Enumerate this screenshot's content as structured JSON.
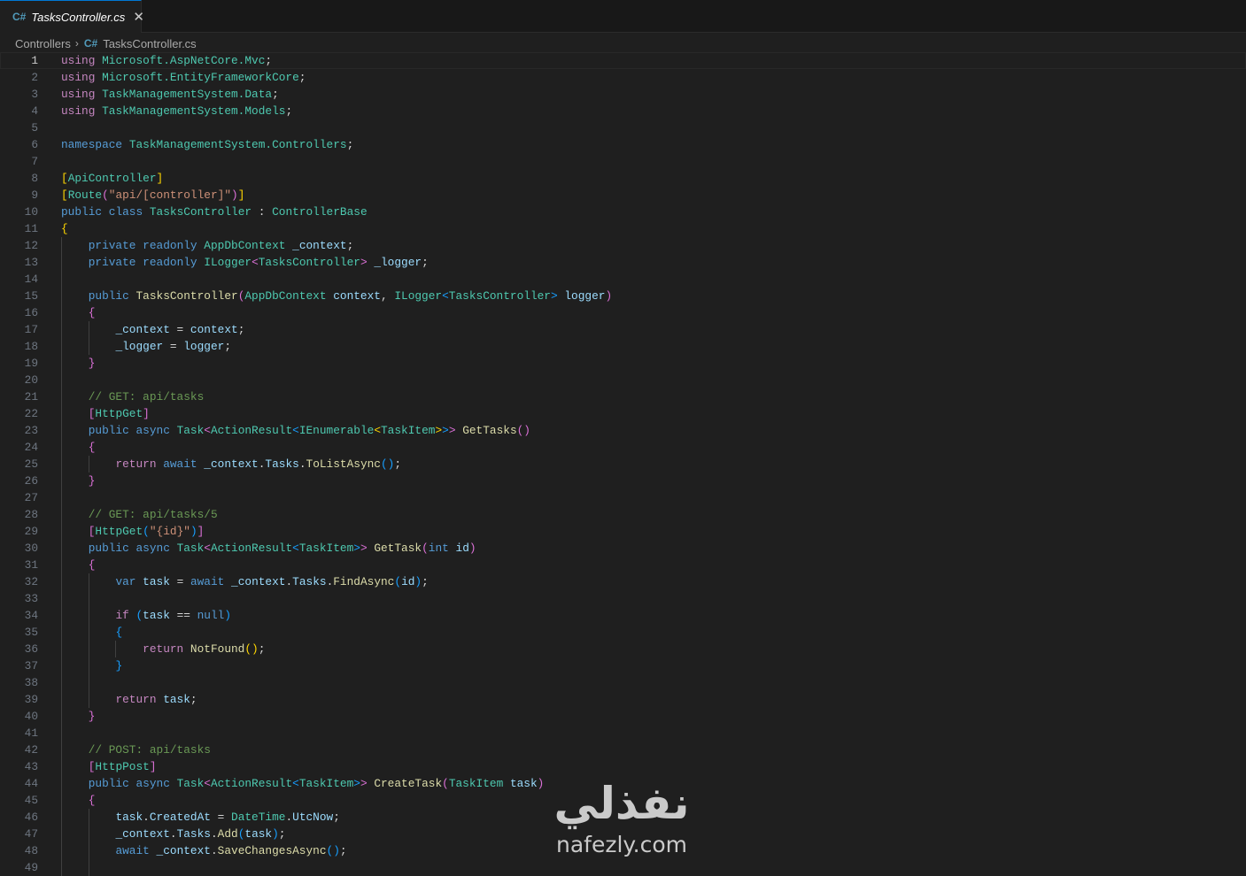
{
  "tab": {
    "icon": "csharp-file-icon",
    "label": "TasksController.cs"
  },
  "breadcrumb": {
    "folder": "Controllers",
    "file": "TasksController.cs"
  },
  "active_line": 1,
  "watermark": {
    "arabic": "نفذلي",
    "latin": "nafezly.com"
  },
  "lines": [
    {
      "n": "1",
      "indent": 0,
      "tokens": [
        [
          "c",
          "using"
        ],
        [
          "p",
          " "
        ],
        [
          "t",
          "Microsoft.AspNetCore.Mvc"
        ],
        [
          "p",
          ";"
        ]
      ]
    },
    {
      "n": "2",
      "indent": 0,
      "tokens": [
        [
          "c",
          "using"
        ],
        [
          "p",
          " "
        ],
        [
          "t",
          "Microsoft.EntityFrameworkCore"
        ],
        [
          "p",
          ";"
        ]
      ]
    },
    {
      "n": "3",
      "indent": 0,
      "tokens": [
        [
          "c",
          "using"
        ],
        [
          "p",
          " "
        ],
        [
          "t",
          "TaskManagementSystem.Data"
        ],
        [
          "p",
          ";"
        ]
      ]
    },
    {
      "n": "4",
      "indent": 0,
      "tokens": [
        [
          "c",
          "using"
        ],
        [
          "p",
          " "
        ],
        [
          "t",
          "TaskManagementSystem.Models"
        ],
        [
          "p",
          ";"
        ]
      ]
    },
    {
      "n": "5",
      "indent": 0,
      "tokens": []
    },
    {
      "n": "6",
      "indent": 0,
      "tokens": [
        [
          "k",
          "namespace"
        ],
        [
          "p",
          " "
        ],
        [
          "t",
          "TaskManagementSystem.Controllers"
        ],
        [
          "p",
          ";"
        ]
      ]
    },
    {
      "n": "7",
      "indent": 0,
      "tokens": []
    },
    {
      "n": "8",
      "indent": 0,
      "tokens": [
        [
          "b1",
          "["
        ],
        [
          "t",
          "ApiController"
        ],
        [
          "b1",
          "]"
        ]
      ]
    },
    {
      "n": "9",
      "indent": 0,
      "tokens": [
        [
          "b1",
          "["
        ],
        [
          "t",
          "Route"
        ],
        [
          "b2",
          "("
        ],
        [
          "s",
          "\"api/[controller]\""
        ],
        [
          "b2",
          ")"
        ],
        [
          "b1",
          "]"
        ]
      ]
    },
    {
      "n": "10",
      "indent": 0,
      "tokens": [
        [
          "k",
          "public"
        ],
        [
          "p",
          " "
        ],
        [
          "k",
          "class"
        ],
        [
          "p",
          " "
        ],
        [
          "t",
          "TasksController"
        ],
        [
          "p",
          " : "
        ],
        [
          "t",
          "ControllerBase"
        ]
      ]
    },
    {
      "n": "11",
      "indent": 0,
      "tokens": [
        [
          "b1",
          "{"
        ]
      ]
    },
    {
      "n": "12",
      "indent": 1,
      "tokens": [
        [
          "k",
          "private"
        ],
        [
          "p",
          " "
        ],
        [
          "k",
          "readonly"
        ],
        [
          "p",
          " "
        ],
        [
          "t",
          "AppDbContext"
        ],
        [
          "p",
          " "
        ],
        [
          "v",
          "_context"
        ],
        [
          "p",
          ";"
        ]
      ]
    },
    {
      "n": "13",
      "indent": 1,
      "tokens": [
        [
          "k",
          "private"
        ],
        [
          "p",
          " "
        ],
        [
          "k",
          "readonly"
        ],
        [
          "p",
          " "
        ],
        [
          "t",
          "ILogger"
        ],
        [
          "b2",
          "<"
        ],
        [
          "t",
          "TasksController"
        ],
        [
          "b2",
          ">"
        ],
        [
          "p",
          " "
        ],
        [
          "v",
          "_logger"
        ],
        [
          "p",
          ";"
        ]
      ]
    },
    {
      "n": "14",
      "indent": 1,
      "tokens": []
    },
    {
      "n": "15",
      "indent": 1,
      "tokens": [
        [
          "k",
          "public"
        ],
        [
          "p",
          " "
        ],
        [
          "f",
          "TasksController"
        ],
        [
          "b2",
          "("
        ],
        [
          "t",
          "AppDbContext"
        ],
        [
          "p",
          " "
        ],
        [
          "v",
          "context"
        ],
        [
          "p",
          ", "
        ],
        [
          "t",
          "ILogger"
        ],
        [
          "b3",
          "<"
        ],
        [
          "t",
          "TasksController"
        ],
        [
          "b3",
          ">"
        ],
        [
          "p",
          " "
        ],
        [
          "v",
          "logger"
        ],
        [
          "b2",
          ")"
        ]
      ]
    },
    {
      "n": "16",
      "indent": 1,
      "tokens": [
        [
          "b2",
          "{"
        ]
      ]
    },
    {
      "n": "17",
      "indent": 2,
      "tokens": [
        [
          "v",
          "_context"
        ],
        [
          "p",
          " = "
        ],
        [
          "v",
          "context"
        ],
        [
          "p",
          ";"
        ]
      ]
    },
    {
      "n": "18",
      "indent": 2,
      "tokens": [
        [
          "v",
          "_logger"
        ],
        [
          "p",
          " = "
        ],
        [
          "v",
          "logger"
        ],
        [
          "p",
          ";"
        ]
      ]
    },
    {
      "n": "19",
      "indent": 1,
      "tokens": [
        [
          "b2",
          "}"
        ]
      ]
    },
    {
      "n": "20",
      "indent": 1,
      "tokens": []
    },
    {
      "n": "21",
      "indent": 1,
      "tokens": [
        [
          "m",
          "// GET: api/tasks"
        ]
      ]
    },
    {
      "n": "22",
      "indent": 1,
      "tokens": [
        [
          "b2",
          "["
        ],
        [
          "t",
          "HttpGet"
        ],
        [
          "b2",
          "]"
        ]
      ]
    },
    {
      "n": "23",
      "indent": 1,
      "tokens": [
        [
          "k",
          "public"
        ],
        [
          "p",
          " "
        ],
        [
          "k",
          "async"
        ],
        [
          "p",
          " "
        ],
        [
          "t",
          "Task"
        ],
        [
          "b2",
          "<"
        ],
        [
          "t",
          "ActionResult"
        ],
        [
          "b3",
          "<"
        ],
        [
          "t",
          "IEnumerable"
        ],
        [
          "b1",
          "<"
        ],
        [
          "t",
          "TaskItem"
        ],
        [
          "b1",
          ">"
        ],
        [
          "b3",
          ">"
        ],
        [
          "b2",
          ">"
        ],
        [
          "p",
          " "
        ],
        [
          "f",
          "GetTasks"
        ],
        [
          "b2",
          "()"
        ]
      ]
    },
    {
      "n": "24",
      "indent": 1,
      "tokens": [
        [
          "b2",
          "{"
        ]
      ]
    },
    {
      "n": "25",
      "indent": 2,
      "tokens": [
        [
          "c",
          "return"
        ],
        [
          "p",
          " "
        ],
        [
          "k",
          "await"
        ],
        [
          "p",
          " "
        ],
        [
          "v",
          "_context"
        ],
        [
          "p",
          "."
        ],
        [
          "v",
          "Tasks"
        ],
        [
          "p",
          "."
        ],
        [
          "f",
          "ToListAsync"
        ],
        [
          "b3",
          "()"
        ],
        [
          "p",
          ";"
        ]
      ]
    },
    {
      "n": "26",
      "indent": 1,
      "tokens": [
        [
          "b2",
          "}"
        ]
      ]
    },
    {
      "n": "27",
      "indent": 1,
      "tokens": []
    },
    {
      "n": "28",
      "indent": 1,
      "tokens": [
        [
          "m",
          "// GET: api/tasks/5"
        ]
      ]
    },
    {
      "n": "29",
      "indent": 1,
      "tokens": [
        [
          "b2",
          "["
        ],
        [
          "t",
          "HttpGet"
        ],
        [
          "b3",
          "("
        ],
        [
          "s",
          "\"{id}\""
        ],
        [
          "b3",
          ")"
        ],
        [
          "b2",
          "]"
        ]
      ]
    },
    {
      "n": "30",
      "indent": 1,
      "tokens": [
        [
          "k",
          "public"
        ],
        [
          "p",
          " "
        ],
        [
          "k",
          "async"
        ],
        [
          "p",
          " "
        ],
        [
          "t",
          "Task"
        ],
        [
          "b2",
          "<"
        ],
        [
          "t",
          "ActionResult"
        ],
        [
          "b3",
          "<"
        ],
        [
          "t",
          "TaskItem"
        ],
        [
          "b3",
          ">"
        ],
        [
          "b2",
          ">"
        ],
        [
          "p",
          " "
        ],
        [
          "f",
          "GetTask"
        ],
        [
          "b2",
          "("
        ],
        [
          "k",
          "int"
        ],
        [
          "p",
          " "
        ],
        [
          "v",
          "id"
        ],
        [
          "b2",
          ")"
        ]
      ]
    },
    {
      "n": "31",
      "indent": 1,
      "tokens": [
        [
          "b2",
          "{"
        ]
      ]
    },
    {
      "n": "32",
      "indent": 2,
      "tokens": [
        [
          "k",
          "var"
        ],
        [
          "p",
          " "
        ],
        [
          "v",
          "task"
        ],
        [
          "p",
          " = "
        ],
        [
          "k",
          "await"
        ],
        [
          "p",
          " "
        ],
        [
          "v",
          "_context"
        ],
        [
          "p",
          "."
        ],
        [
          "v",
          "Tasks"
        ],
        [
          "p",
          "."
        ],
        [
          "f",
          "FindAsync"
        ],
        [
          "b3",
          "("
        ],
        [
          "v",
          "id"
        ],
        [
          "b3",
          ")"
        ],
        [
          "p",
          ";"
        ]
      ]
    },
    {
      "n": "33",
      "indent": 2,
      "tokens": []
    },
    {
      "n": "34",
      "indent": 2,
      "tokens": [
        [
          "c",
          "if"
        ],
        [
          "p",
          " "
        ],
        [
          "b3",
          "("
        ],
        [
          "v",
          "task"
        ],
        [
          "p",
          " == "
        ],
        [
          "k",
          "null"
        ],
        [
          "b3",
          ")"
        ]
      ]
    },
    {
      "n": "35",
      "indent": 2,
      "tokens": [
        [
          "b3",
          "{"
        ]
      ]
    },
    {
      "n": "36",
      "indent": 3,
      "tokens": [
        [
          "c",
          "return"
        ],
        [
          "p",
          " "
        ],
        [
          "f",
          "NotFound"
        ],
        [
          "b1",
          "()"
        ],
        [
          "p",
          ";"
        ]
      ]
    },
    {
      "n": "37",
      "indent": 2,
      "tokens": [
        [
          "b3",
          "}"
        ]
      ]
    },
    {
      "n": "38",
      "indent": 2,
      "tokens": []
    },
    {
      "n": "39",
      "indent": 2,
      "tokens": [
        [
          "c",
          "return"
        ],
        [
          "p",
          " "
        ],
        [
          "v",
          "task"
        ],
        [
          "p",
          ";"
        ]
      ]
    },
    {
      "n": "40",
      "indent": 1,
      "tokens": [
        [
          "b2",
          "}"
        ]
      ]
    },
    {
      "n": "41",
      "indent": 1,
      "tokens": []
    },
    {
      "n": "42",
      "indent": 1,
      "tokens": [
        [
          "m",
          "// POST: api/tasks"
        ]
      ]
    },
    {
      "n": "43",
      "indent": 1,
      "tokens": [
        [
          "b2",
          "["
        ],
        [
          "t",
          "HttpPost"
        ],
        [
          "b2",
          "]"
        ]
      ]
    },
    {
      "n": "44",
      "indent": 1,
      "tokens": [
        [
          "k",
          "public"
        ],
        [
          "p",
          " "
        ],
        [
          "k",
          "async"
        ],
        [
          "p",
          " "
        ],
        [
          "t",
          "Task"
        ],
        [
          "b2",
          "<"
        ],
        [
          "t",
          "ActionResult"
        ],
        [
          "b3",
          "<"
        ],
        [
          "t",
          "TaskItem"
        ],
        [
          "b3",
          ">"
        ],
        [
          "b2",
          ">"
        ],
        [
          "p",
          " "
        ],
        [
          "f",
          "CreateTask"
        ],
        [
          "b2",
          "("
        ],
        [
          "t",
          "TaskItem"
        ],
        [
          "p",
          " "
        ],
        [
          "v",
          "task"
        ],
        [
          "b2",
          ")"
        ]
      ]
    },
    {
      "n": "45",
      "indent": 1,
      "tokens": [
        [
          "b2",
          "{"
        ]
      ]
    },
    {
      "n": "46",
      "indent": 2,
      "tokens": [
        [
          "v",
          "task"
        ],
        [
          "p",
          "."
        ],
        [
          "v",
          "CreatedAt"
        ],
        [
          "p",
          " = "
        ],
        [
          "t",
          "DateTime"
        ],
        [
          "p",
          "."
        ],
        [
          "v",
          "UtcNow"
        ],
        [
          "p",
          ";"
        ]
      ]
    },
    {
      "n": "47",
      "indent": 2,
      "tokens": [
        [
          "v",
          "_context"
        ],
        [
          "p",
          "."
        ],
        [
          "v",
          "Tasks"
        ],
        [
          "p",
          "."
        ],
        [
          "f",
          "Add"
        ],
        [
          "b3",
          "("
        ],
        [
          "v",
          "task"
        ],
        [
          "b3",
          ")"
        ],
        [
          "p",
          ";"
        ]
      ]
    },
    {
      "n": "48",
      "indent": 2,
      "tokens": [
        [
          "k",
          "await"
        ],
        [
          "p",
          " "
        ],
        [
          "v",
          "_context"
        ],
        [
          "p",
          "."
        ],
        [
          "f",
          "SaveChangesAsync"
        ],
        [
          "b3",
          "()"
        ],
        [
          "p",
          ";"
        ]
      ]
    },
    {
      "n": "49",
      "indent": 2,
      "tokens": []
    }
  ]
}
